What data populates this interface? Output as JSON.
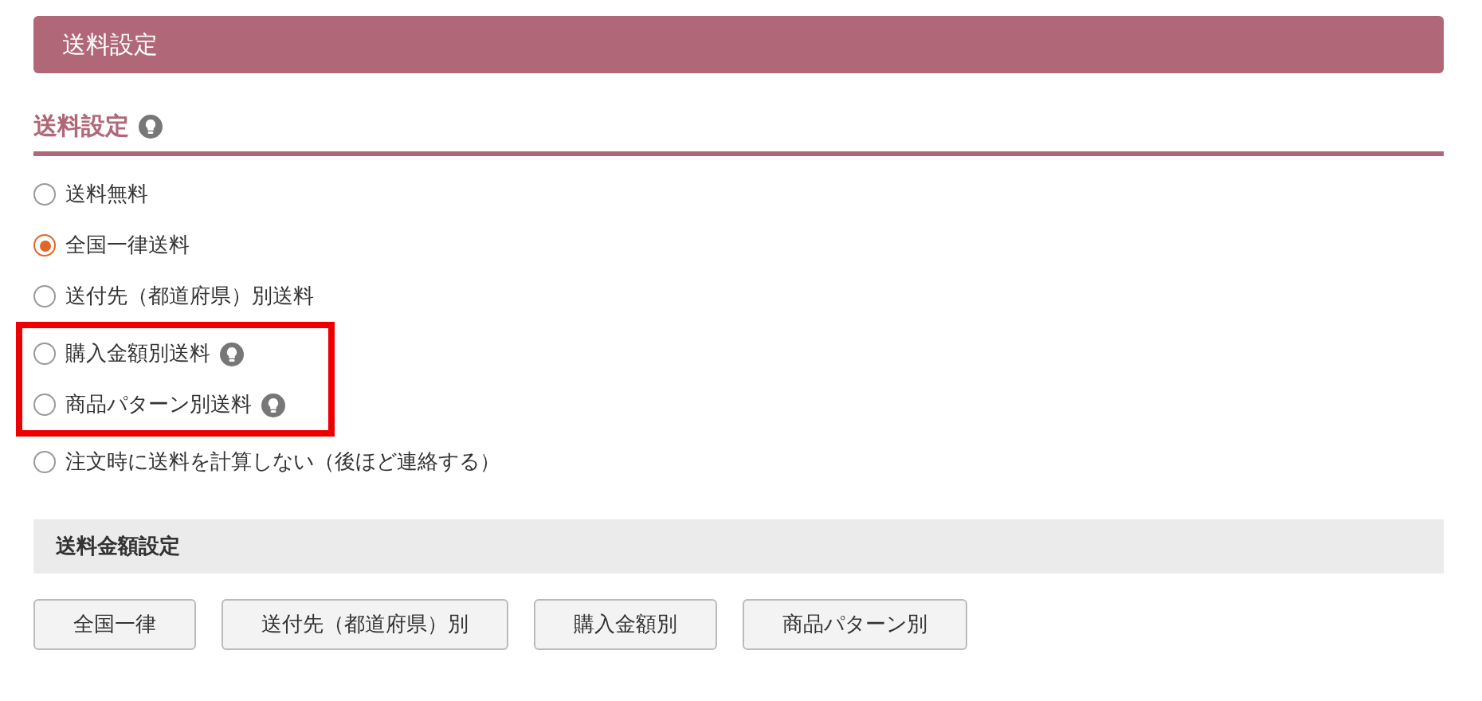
{
  "panel": {
    "title": "送料設定"
  },
  "section": {
    "title": "送料設定",
    "hint": true
  },
  "options": [
    {
      "label": "送料無料",
      "selected": false,
      "highlighted": false
    },
    {
      "label": "全国一律送料",
      "selected": true,
      "highlighted": false
    },
    {
      "label": "送付先（都道府県）別送料",
      "selected": false,
      "highlighted": false
    },
    {
      "label": "購入金額別送料",
      "selected": false,
      "hint": true,
      "highlighted": true
    },
    {
      "label": "商品パターン別送料",
      "selected": false,
      "hint": true,
      "highlighted": true
    },
    {
      "label": "注文時に送料を計算しない（後ほど連絡する）",
      "selected": false,
      "highlighted": false
    }
  ],
  "amount_settings": {
    "title": "送料金額設定",
    "buttons": [
      "全国一律",
      "送付先（都道府県）別",
      "購入金額別",
      "商品パターン別"
    ]
  }
}
